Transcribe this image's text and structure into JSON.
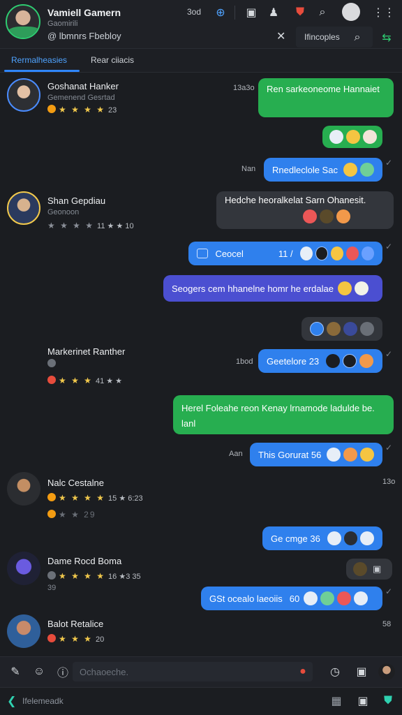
{
  "header": {
    "name": "Vamiell Gamern",
    "subtitle": "Gaomirili",
    "status": "@ lbmnrs Fbebloy",
    "count": "3od",
    "search_label": "Ifincoples",
    "icons": [
      "link-icon",
      "upload-icon",
      "users-icon",
      "shield-icon",
      "search-icon",
      "profile-icon",
      "menu-icon",
      "close-icon",
      "search-icon",
      "split-icon"
    ]
  },
  "tabs": [
    {
      "label": "Rermalheasies",
      "active": true
    },
    {
      "label": "Rear ciiacis",
      "active": false
    }
  ],
  "contacts": [
    {
      "name": "Goshanat Hanker",
      "sub": "Gemenend Gesrtad",
      "stars": "★ ★ ★ ★",
      "rating": "23",
      "time": "13a3o"
    },
    {
      "name": "Shan Gepdiau",
      "sub": "Geonoon",
      "stars": "★ ★ ★ ★",
      "rating": "11 ★ ★ 10",
      "time": ""
    },
    {
      "name": "Markerinet Ranther",
      "sub": "",
      "stars": "★ ★ ★",
      "rating": "41 ★ ★",
      "time": "1bod"
    },
    {
      "name": "Nalc Cestalne",
      "sub": "",
      "stars": "★ ★ ★ ★",
      "rating": "15 ★ 6:23",
      "time": "13o",
      "extra": "★ ★ 29"
    },
    {
      "name": "Dame Rocd Boma",
      "sub": "39",
      "stars": "★ ★ ★ ★",
      "rating": "16 ★3 35",
      "time": ""
    },
    {
      "name": "Balot Retalice",
      "sub": "",
      "stars": "★ ★ ★",
      "rating": "20",
      "time": "58"
    }
  ],
  "messages": [
    {
      "text": "Ren sarkeoneome Hannaiet",
      "color": "green"
    },
    {
      "text": "",
      "color": "green",
      "emojis": 3
    },
    {
      "text": "Rnedleclole Sac",
      "color": "blue",
      "time": "Nan"
    },
    {
      "text": "Hedche heoralkelat Sarn Ohanesit.",
      "color": "dark"
    },
    {
      "text": "Ceocel",
      "color": "blue",
      "mid": "11 /"
    },
    {
      "text": "Seogers cem hhanelne homr he erdalae",
      "color": "purple"
    },
    {
      "text": "",
      "color": "dark",
      "emojis": 4
    },
    {
      "text": "Geetelore 23",
      "color": "blue"
    },
    {
      "text": "Herel Foleahe reon Kenay lrnamode ladulde be. lanl",
      "color": "green"
    },
    {
      "text": "This Gorurat 56",
      "color": "blue",
      "time": "Aan"
    },
    {
      "text": "Ge cmge 36",
      "color": "blue"
    },
    {
      "text": "GSt ocealo laeoiis",
      "color": "blue",
      "mid": "60"
    }
  ],
  "composer": {
    "placeholder": "Ochaoeche.",
    "icons": [
      "attach-icon",
      "emoji-icon",
      "info-icon",
      "clock-icon",
      "media-icon"
    ]
  },
  "bottombar": {
    "label": "Ifelemeadk"
  },
  "colors": {
    "accent_blue": "#2f80ed",
    "accent_green": "#27ae50",
    "background": "#1b1d21"
  }
}
